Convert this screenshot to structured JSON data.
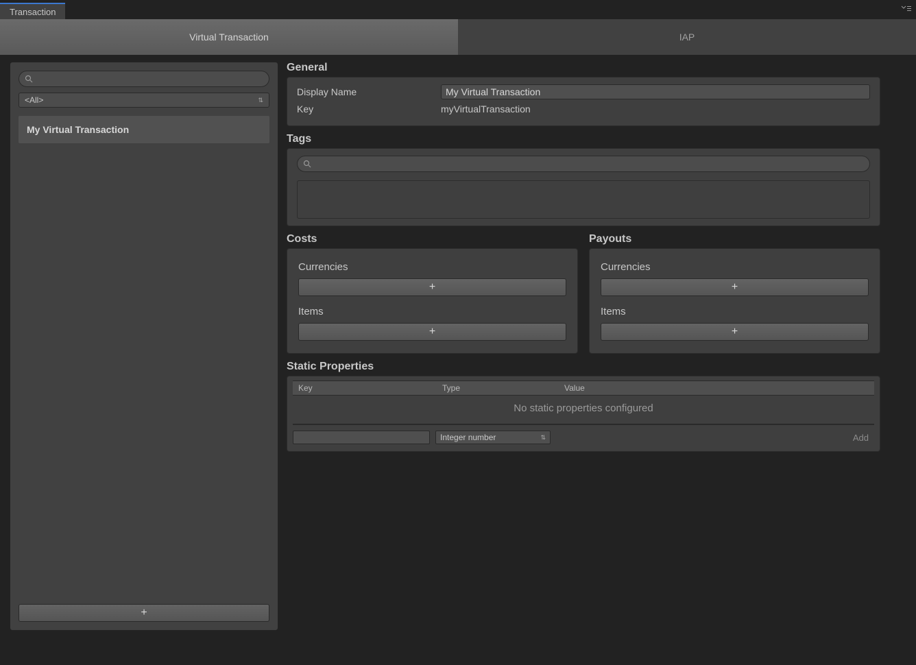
{
  "window": {
    "tab_title": "Transaction"
  },
  "sub_tabs": {
    "virtual": "Virtual Transaction",
    "iap": "IAP"
  },
  "sidebar": {
    "search_placeholder": "",
    "filter_label": "<All>",
    "items": [
      "My Virtual Transaction"
    ],
    "add_label": "+"
  },
  "general": {
    "title": "General",
    "display_name_label": "Display Name",
    "display_name_value": "My Virtual Transaction",
    "key_label": "Key",
    "key_value": "myVirtualTransaction"
  },
  "tags": {
    "title": "Tags",
    "search_placeholder": ""
  },
  "costs": {
    "title": "Costs",
    "currencies_label": "Currencies",
    "items_label": "Items",
    "add_label": "+"
  },
  "payouts": {
    "title": "Payouts",
    "currencies_label": "Currencies",
    "items_label": "Items",
    "add_label": "+"
  },
  "static_props": {
    "title": "Static Properties",
    "col_key": "Key",
    "col_type": "Type",
    "col_value": "Value",
    "empty_text": "No static properties configured",
    "type_dropdown": "Integer number",
    "add_button": "Add"
  }
}
